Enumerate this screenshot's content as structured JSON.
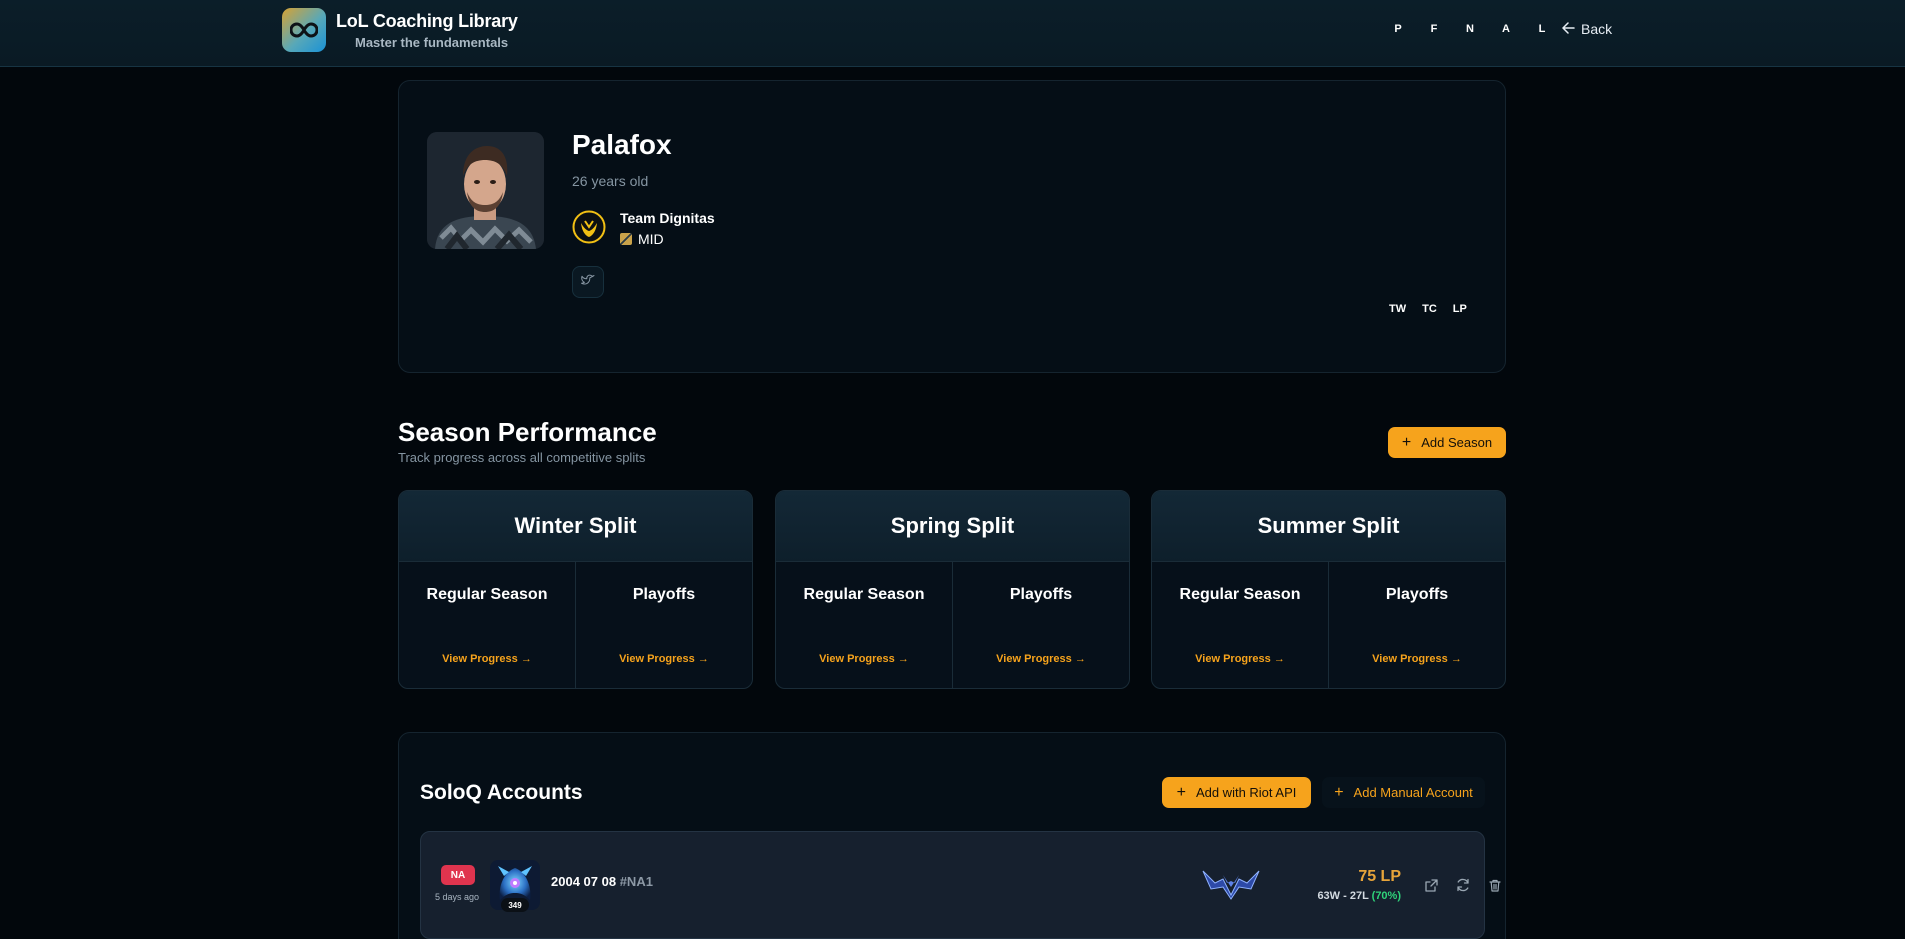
{
  "header": {
    "title": "LoL Coaching Library",
    "subtitle": "Master the fundamentals",
    "nav": [
      "P",
      "F",
      "N",
      "A",
      "L"
    ],
    "back_label": "Back"
  },
  "profile": {
    "name": "Palafox",
    "age": "26 years old",
    "team": "Team Dignitas",
    "role": "MID",
    "links": [
      "TW",
      "TC",
      "LP"
    ]
  },
  "seasons": {
    "title": "Season Performance",
    "subtitle": "Track progress across all competitive splits",
    "add_label": "Add Season",
    "splits": [
      {
        "name": "Winter Split",
        "phases": [
          "Regular Season",
          "Playoffs"
        ]
      },
      {
        "name": "Spring Split",
        "phases": [
          "Regular Season",
          "Playoffs"
        ]
      },
      {
        "name": "Summer Split",
        "phases": [
          "Regular Season",
          "Playoffs"
        ]
      }
    ],
    "view_label": "View Progress →"
  },
  "soloq": {
    "title": "SoloQ Accounts",
    "add_riot_label": "Add with Riot API",
    "add_manual_label": "Add Manual Account",
    "accounts": [
      {
        "region": "NA",
        "updated": "5 days ago",
        "level": "349",
        "name": "2004 07 08",
        "tag": "#NA1",
        "lp": "75 LP",
        "record": "63W - 27L",
        "winrate": "(70%)"
      }
    ]
  },
  "colors": {
    "accent": "#f6a31c",
    "region_badge": "#e0344e",
    "winrate": "#2fd37a",
    "background": "#02070c"
  },
  "icons": [
    "infinity-icon",
    "arrow-left-icon",
    "twitter-icon",
    "plus-icon",
    "external-link-icon",
    "refresh-icon",
    "trash-icon"
  ]
}
